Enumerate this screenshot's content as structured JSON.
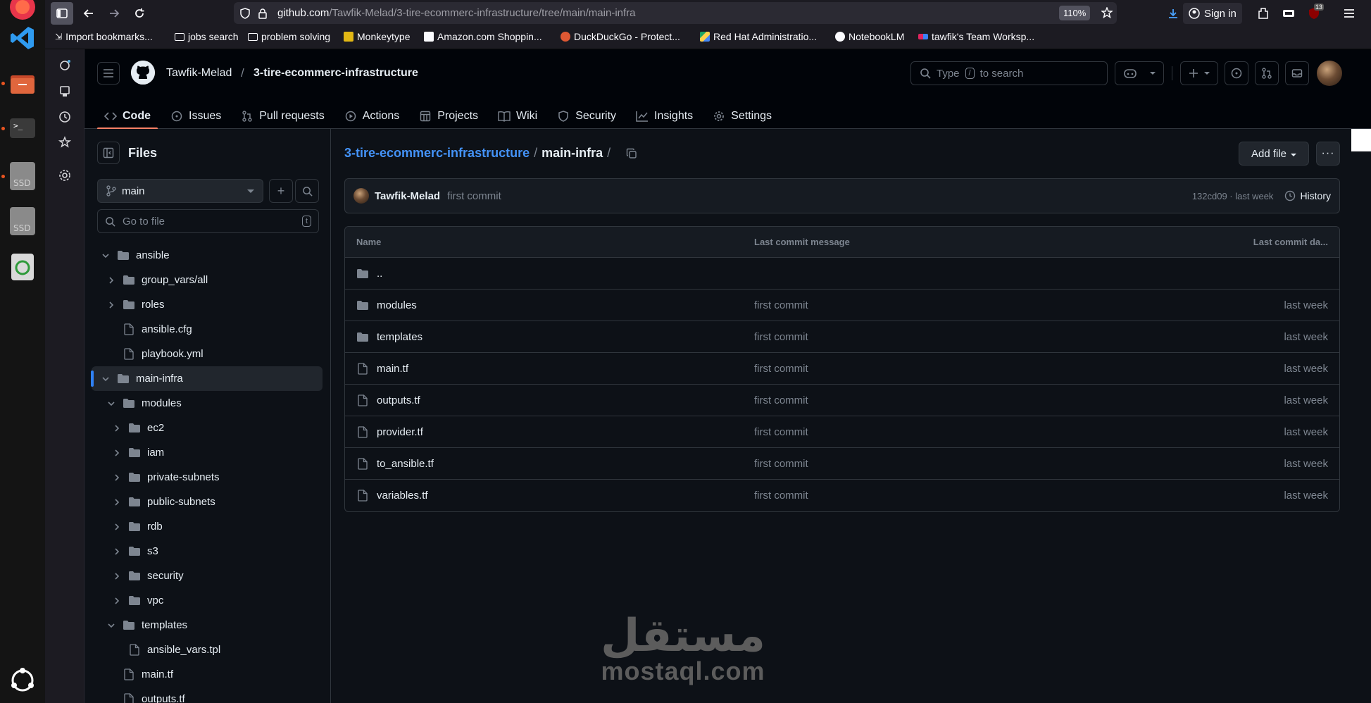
{
  "browser": {
    "url_host": "github.com",
    "url_path": "/Tawfik-Melad/3-tire-ecommerc-infrastructure/tree/main/main-infra",
    "zoom": "110%",
    "sign_in": "Sign in",
    "notification_count": "13",
    "bookmarks": [
      "Import bookmarks...",
      "jobs search",
      "problem solving",
      "Monkeytype",
      "Amazon.com Shoppin...",
      "DuckDuckGo - Protect...",
      "Red Hat Administratio...",
      "NotebookLM",
      "tawfik's Team Worksp..."
    ]
  },
  "header": {
    "owner": "Tawfik-Melad",
    "separator": "/",
    "repo": "3-tire-ecommerc-infrastructure",
    "search_prefix": "Type",
    "search_key": "/",
    "search_suffix": "to search"
  },
  "tabs": [
    {
      "label": "Code",
      "icon": "code-icon"
    },
    {
      "label": "Issues",
      "icon": "issue-icon"
    },
    {
      "label": "Pull requests",
      "icon": "pull-request-icon"
    },
    {
      "label": "Actions",
      "icon": "play-icon"
    },
    {
      "label": "Projects",
      "icon": "table-icon"
    },
    {
      "label": "Wiki",
      "icon": "book-icon"
    },
    {
      "label": "Security",
      "icon": "shield-icon"
    },
    {
      "label": "Insights",
      "icon": "graph-icon"
    },
    {
      "label": "Settings",
      "icon": "gear-icon"
    }
  ],
  "files_panel": {
    "title": "Files",
    "branch": "main",
    "goto_placeholder": "Go to file",
    "goto_key": "t",
    "tree": [
      {
        "label": "ansible",
        "type": "folder",
        "depth": 0,
        "expanded": true
      },
      {
        "label": "group_vars/all",
        "type": "folder",
        "depth": 1,
        "expanded": false
      },
      {
        "label": "roles",
        "type": "folder",
        "depth": 1,
        "expanded": false
      },
      {
        "label": "ansible.cfg",
        "type": "file",
        "depth": 1
      },
      {
        "label": "playbook.yml",
        "type": "file",
        "depth": 1
      },
      {
        "label": "main-infra",
        "type": "folder",
        "depth": 0,
        "expanded": true,
        "selected": true
      },
      {
        "label": "modules",
        "type": "folder",
        "depth": 1,
        "expanded": true
      },
      {
        "label": "ec2",
        "type": "folder",
        "depth": 2,
        "expanded": false
      },
      {
        "label": "iam",
        "type": "folder",
        "depth": 2,
        "expanded": false
      },
      {
        "label": "private-subnets",
        "type": "folder",
        "depth": 2,
        "expanded": false
      },
      {
        "label": "public-subnets",
        "type": "folder",
        "depth": 2,
        "expanded": false
      },
      {
        "label": "rdb",
        "type": "folder",
        "depth": 2,
        "expanded": false
      },
      {
        "label": "s3",
        "type": "folder",
        "depth": 2,
        "expanded": false
      },
      {
        "label": "security",
        "type": "folder",
        "depth": 2,
        "expanded": false
      },
      {
        "label": "vpc",
        "type": "folder",
        "depth": 2,
        "expanded": false
      },
      {
        "label": "templates",
        "type": "folder",
        "depth": 1,
        "expanded": true
      },
      {
        "label": "ansible_vars.tpl",
        "type": "file",
        "depth": 2
      },
      {
        "label": "main.tf",
        "type": "file",
        "depth": 1
      },
      {
        "label": "outputs.tf",
        "type": "file",
        "depth": 1
      }
    ]
  },
  "main": {
    "path_repo": "3-tire-ecommerc-infrastructure",
    "path_sep": "/",
    "path_dir": "main-infra",
    "add_file": "Add file",
    "more": "···",
    "commit": {
      "author": "Tawfik-Melad",
      "message": "first commit",
      "meta": "132cd09 · last week",
      "history": "History"
    },
    "columns": [
      "Name",
      "Last commit message",
      "Last commit da..."
    ],
    "rows": [
      {
        "name": "..",
        "type": "folder",
        "message": "",
        "date": ""
      },
      {
        "name": "modules",
        "type": "folder",
        "message": "first commit",
        "date": "last week"
      },
      {
        "name": "templates",
        "type": "folder",
        "message": "first commit",
        "date": "last week"
      },
      {
        "name": "main.tf",
        "type": "file",
        "message": "first commit",
        "date": "last week"
      },
      {
        "name": "outputs.tf",
        "type": "file",
        "message": "first commit",
        "date": "last week"
      },
      {
        "name": "provider.tf",
        "type": "file",
        "message": "first commit",
        "date": "last week"
      },
      {
        "name": "to_ansible.tf",
        "type": "file",
        "message": "first commit",
        "date": "last week"
      },
      {
        "name": "variables.tf",
        "type": "file",
        "message": "first commit",
        "date": "last week"
      }
    ]
  },
  "watermark": {
    "arabic": "مستقل",
    "latin": "mostaql.com"
  },
  "colors": {
    "accent_tab": "#f78166",
    "link": "#4493f8",
    "folder": "#7d8590"
  }
}
